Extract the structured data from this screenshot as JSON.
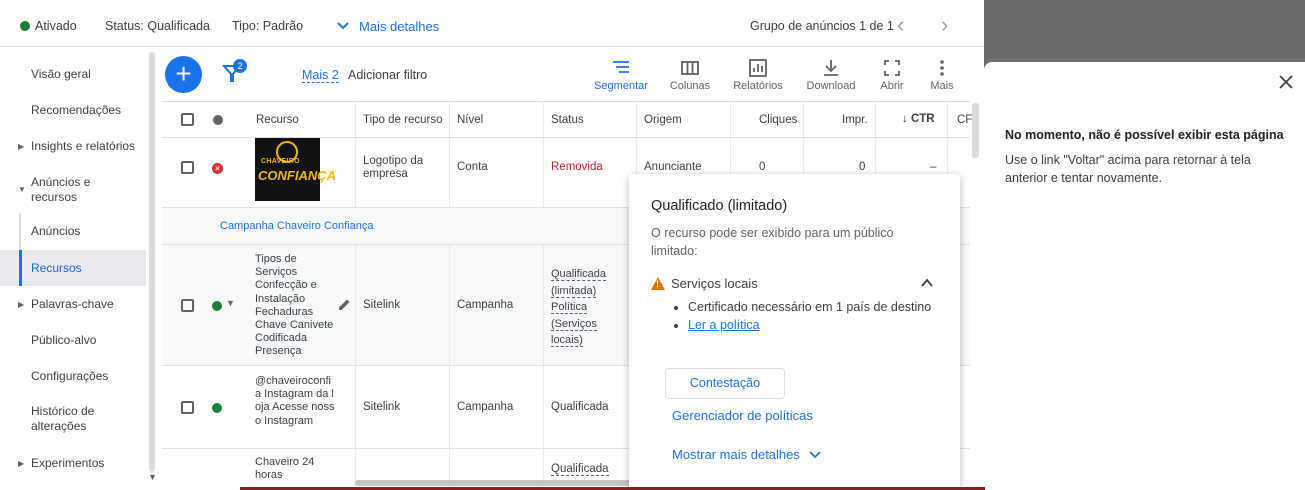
{
  "header": {
    "status_active": "Ativado",
    "status": "Status: Qualificada",
    "type": "Tipo: Padrão",
    "more_details": "Mais detalhes",
    "group_pager": "Grupo de anúncios 1 de 1"
  },
  "sidebar": {
    "items": [
      {
        "label": "Visão geral"
      },
      {
        "label": "Recomendações"
      },
      {
        "label": "Insights e relatórios"
      },
      {
        "label": "Anúncios e recursos"
      },
      {
        "label": "Anúncios"
      },
      {
        "label": "Recursos"
      },
      {
        "label": "Palavras-chave"
      },
      {
        "label": "Público-alvo"
      },
      {
        "label": "Configurações"
      },
      {
        "label": "Histórico de alterações"
      },
      {
        "label": "Experimentos"
      }
    ]
  },
  "toolbar": {
    "filter_count": "2",
    "more_filters": "Mais 2",
    "add_filter": "Adicionar filtro",
    "segment": "Segmentar",
    "columns": "Colunas",
    "reports": "Relatórios",
    "download": "Download",
    "open": "Abrir",
    "more": "Mais"
  },
  "table": {
    "headers": {
      "resource": "Recurso",
      "resource_type": "Tipo de recurso",
      "level": "Nível",
      "status": "Status",
      "origin": "Origem",
      "clicks": "Cliques",
      "impr": "Impr.",
      "ctr": "CTR",
      "cpc": "CF"
    },
    "row1": {
      "logo_top": "CHAVEIRO",
      "logo_main": "CONFIANÇA",
      "type": "Logotipo da empresa",
      "level": "Conta",
      "status": "Removida",
      "origin": "Anunciante",
      "clicks": "0",
      "impr": "0",
      "ctr": "–"
    },
    "campaign_label": "Campanha Chaveiro Confiança",
    "row2": {
      "resource_lines": "Tipos de Serviços Confecção e Instalação Fechaduras Chave Canivete Codificada Presença",
      "type": "Sitelink",
      "level": "Campanha",
      "status": "Qualificada (limitada) Política (Serviços locais)"
    },
    "row3": {
      "resource_lines": "@chaveiroconfia Instagram da loja Acesse nosso Instagram",
      "type": "Sitelink",
      "level": "Campanha",
      "status": "Qualificada"
    },
    "row4": {
      "resource_lines": "Chaveiro 24 horas",
      "status": "Qualificada"
    }
  },
  "popover": {
    "title": "Qualificado (limitado)",
    "description": "O recurso pode ser exibido para um público limitado:",
    "section": "Serviços locais",
    "bullet1": "Certificado necessário em 1 país de destino",
    "bullet2": "Ler a política",
    "appeal_button": "Contestação",
    "policy_manager": "Gerenciador de políticas",
    "show_more": "Mostrar mais detalhes"
  },
  "right_panel": {
    "title": "No momento, não é possível exibir esta página",
    "description": "Use o link \"Voltar\" acima para retornar à tela anterior e tentar novamente."
  }
}
